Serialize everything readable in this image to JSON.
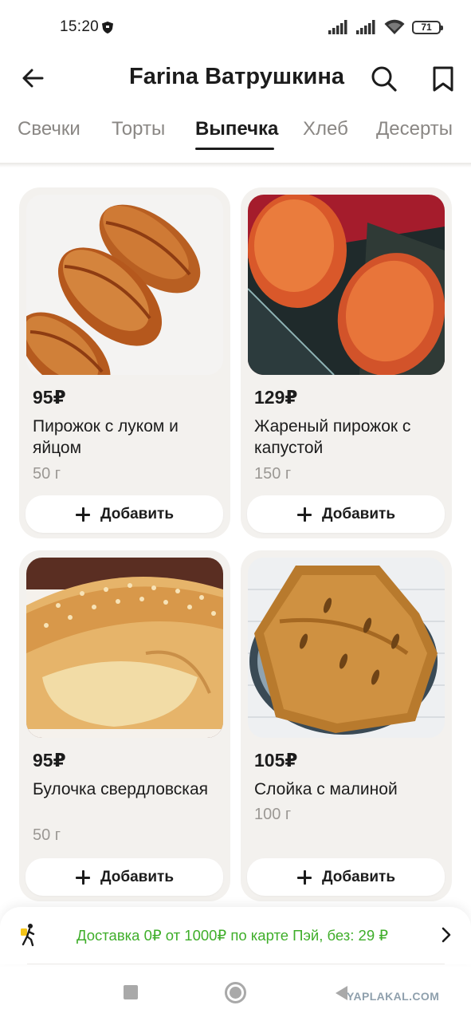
{
  "status_bar": {
    "time": "15:20",
    "battery": "71"
  },
  "header": {
    "title": "Farina Ватрушкина"
  },
  "tabs": [
    {
      "label": "Свечки",
      "active": false
    },
    {
      "label": "Торты",
      "active": false
    },
    {
      "label": "Выпечка",
      "active": true
    },
    {
      "label": "Хлеб",
      "active": false
    },
    {
      "label": "Десерты",
      "active": false
    }
  ],
  "products": [
    {
      "price": "95₽",
      "name": "Пирожок с луком и яйцом",
      "weight": "50 г",
      "add_label": "Добавить"
    },
    {
      "price": "129₽",
      "name": "Жареный пирожок с капустой",
      "weight": "150 г",
      "add_label": "Добавить"
    },
    {
      "price": "95₽",
      "name": "Булочка свердловская",
      "weight": "50 г",
      "add_label": "Добавить"
    },
    {
      "price": "105₽",
      "name": "Слойка с малиной",
      "weight": "100 г",
      "add_label": "Добавить"
    }
  ],
  "delivery": {
    "text": "Доставка 0₽ от 1000₽ по карте Пэй, без: 29 ₽",
    "color": "#3fae2a"
  },
  "watermark": "YAPLAKAL.COM",
  "colors": {
    "card_background": "#f3f1ee",
    "text_primary": "#1c1c1c",
    "text_secondary": "#9b9894",
    "tab_inactive": "#8a8784"
  }
}
